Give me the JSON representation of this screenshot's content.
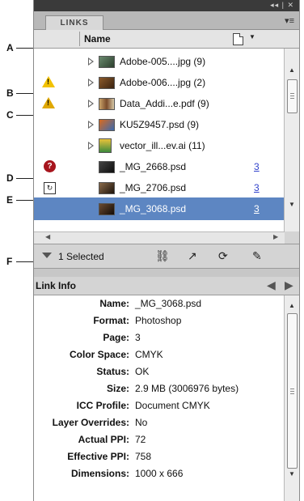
{
  "callouts": [
    "A",
    "B",
    "C",
    "D",
    "E",
    "F"
  ],
  "panel": {
    "title_controls": "◂◂ | ✕",
    "tab": "LINKS",
    "menu_icon": "panel-menu-icon",
    "column_name": "Name",
    "page_column_icon": "page-icon"
  },
  "links": [
    {
      "name": "Adobe-005....jpg (9)",
      "status": "none",
      "expandable": true,
      "page": ""
    },
    {
      "name": "Adobe-006....jpg (2)",
      "status": "warning-yellow",
      "expandable": true,
      "page": ""
    },
    {
      "name": "Data_Addi...e.pdf (9)",
      "status": "warning-outline",
      "expandable": true,
      "page": ""
    },
    {
      "name": "KU5Z9457.psd (9)",
      "status": "none",
      "expandable": true,
      "page": ""
    },
    {
      "name": "vector_ill...ev.ai (11)",
      "status": "none",
      "expandable": true,
      "page": ""
    },
    {
      "name": "_MG_2668.psd",
      "status": "missing",
      "expandable": false,
      "page": "3"
    },
    {
      "name": "_MG_2706.psd",
      "status": "modified",
      "expandable": false,
      "page": "3"
    },
    {
      "name": "_MG_3068.psd",
      "status": "none",
      "expandable": false,
      "page": "3",
      "selected": true
    }
  ],
  "status_bar": {
    "selected_text": "1 Selected",
    "icons": [
      "relink-icon",
      "goto-link-icon",
      "update-link-icon",
      "edit-original-icon"
    ]
  },
  "link_info": {
    "title": "Link Info",
    "fields": [
      {
        "label": "Name:",
        "value": "_MG_3068.psd"
      },
      {
        "label": "Format:",
        "value": "Photoshop"
      },
      {
        "label": "Page:",
        "value": "3"
      },
      {
        "label": "Color Space:",
        "value": "CMYK"
      },
      {
        "label": "Status:",
        "value": "OK"
      },
      {
        "label": "Size:",
        "value": "2.9 MB (3006976 bytes)"
      },
      {
        "label": "ICC Profile:",
        "value": "Document CMYK"
      },
      {
        "label": "Layer Overrides:",
        "value": "No"
      },
      {
        "label": "Actual PPI:",
        "value": "72"
      },
      {
        "label": "Effective PPI:",
        "value": "758"
      },
      {
        "label": "Dimensions:",
        "value": "1000 x 666"
      }
    ]
  },
  "colors": {
    "selection": "#5d86c2",
    "warning": "#f2c200",
    "missing": "#a7151d",
    "page_link": "#3344cc"
  }
}
